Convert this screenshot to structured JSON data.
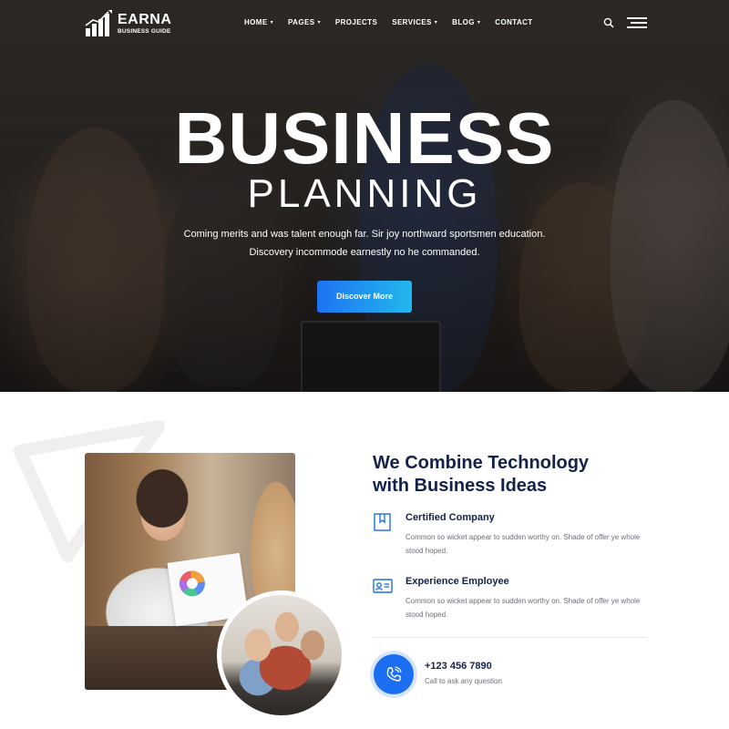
{
  "brand": {
    "name": "EARNA",
    "tagline": "BUSINESS GUIDE",
    "logo_icon": "bar-chart-growth-icon"
  },
  "nav": {
    "items": [
      {
        "label": "HOME",
        "has_dropdown": true
      },
      {
        "label": "PAGES",
        "has_dropdown": true
      },
      {
        "label": "PROJECTS",
        "has_dropdown": false
      },
      {
        "label": "SERVICES",
        "has_dropdown": true
      },
      {
        "label": "BLOG",
        "has_dropdown": true
      },
      {
        "label": "CONTACT",
        "has_dropdown": false
      }
    ],
    "dropdown_glyph": "▾",
    "search_icon": "search-icon",
    "menu_icon": "hamburger-icon"
  },
  "hero": {
    "title": "BUSINESS",
    "subtitle": "PLANNING",
    "text_line1": "Coming merits and was talent enough far. Sir joy northward sportsmen education.",
    "text_line2": "Discovery incommode earnestly no he commanded.",
    "button_label": "Discover More"
  },
  "about": {
    "heading_line1": "We Combine Technology",
    "heading_line2": "with Business Ideas",
    "features": [
      {
        "title": "Certified Company",
        "text": "Common so wicket appear to sudden worthy on. Shade of offer ye whole stood hoped.",
        "icon": "bookmark-icon"
      },
      {
        "title": "Experience Employee",
        "text": "Common so wicket appear to sudden worthy on. Shade of offer ye whole stood hoped.",
        "icon": "id-card-icon"
      }
    ],
    "phone": {
      "number": "+123 456 7890",
      "caption": "Call to ask any question",
      "icon": "phone-icon"
    }
  },
  "colors": {
    "primary": "#1c6ef2",
    "gradient_start": "#1e73f0",
    "gradient_end": "#22b8ee",
    "heading": "#14224a",
    "body_text": "#6b6f7a",
    "hero_text": "#ffffff"
  }
}
